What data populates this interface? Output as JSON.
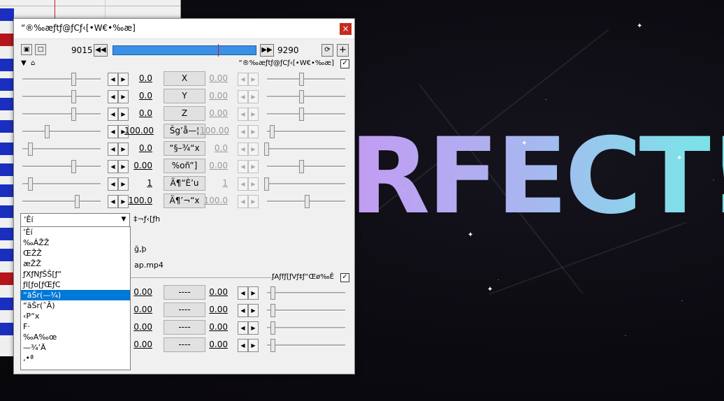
{
  "preview": {
    "text": "RFECT!!"
  },
  "dialog": {
    "title": "“®‰æƒtƒ@ƒCƒ‹[•W€•‰æ]",
    "close_label": "×",
    "frame_start": "9015",
    "frame_end": "9290",
    "section1_label": "“®‰æƒtƒ@ƒCƒ‹[•W€•‰æ]",
    "section2_label": "ƒAƒfƒ[ƒVƒ‡ƒ“Œø‰Ê"
  },
  "params": [
    {
      "label": "X",
      "left": "0.0",
      "right": "0.00"
    },
    {
      "label": "Y",
      "left": "0.0",
      "right": "0.00"
    },
    {
      "label": "Z",
      "left": "0.0",
      "right": "0.00"
    },
    {
      "label": "Šg’å—¦",
      "left": "100.00",
      "right": "100.00"
    },
    {
      "label": "“§–¾“x",
      "left": "0.0",
      "right": "0.0"
    },
    {
      "label": "%oñ”]",
      "left": "0.00",
      "right": "0.00"
    },
    {
      "label": "Ä¶“È’u",
      "left": "1",
      "right": "1"
    },
    {
      "label": "Ä¶’¬“x",
      "left": "100.0",
      "right": "100.0"
    }
  ],
  "blend": {
    "selected": "’Êí",
    "side_label": "‡¬ƒ‹[ƒh",
    "options": [
      "’Êí",
      "‰ÁŽŽ",
      "ŒŽŽ",
      "æŽŽ",
      "ƒXƒNƒŠŠ[ƒ“",
      "ƒI[ƒo[ƒŒƒC",
      "“äŠr(—¾)",
      "“äŠr(ˆÃ)",
      "‹P“x",
      "F·",
      "‰A‰œ",
      "—¾’Ä",
      "‚•ª"
    ]
  },
  "file": {
    "name": "ap.mp4",
    "partial": "ğ,þ"
  },
  "section2": [
    {
      "left": "0.00",
      "label": "----",
      "right": "0.00"
    },
    {
      "left": "0.00",
      "label": "----",
      "right": "0.00"
    },
    {
      "left": "0.00",
      "label": "----",
      "right": "0.00"
    },
    {
      "left": "0.00",
      "label": "----",
      "right": "0.00"
    }
  ]
}
